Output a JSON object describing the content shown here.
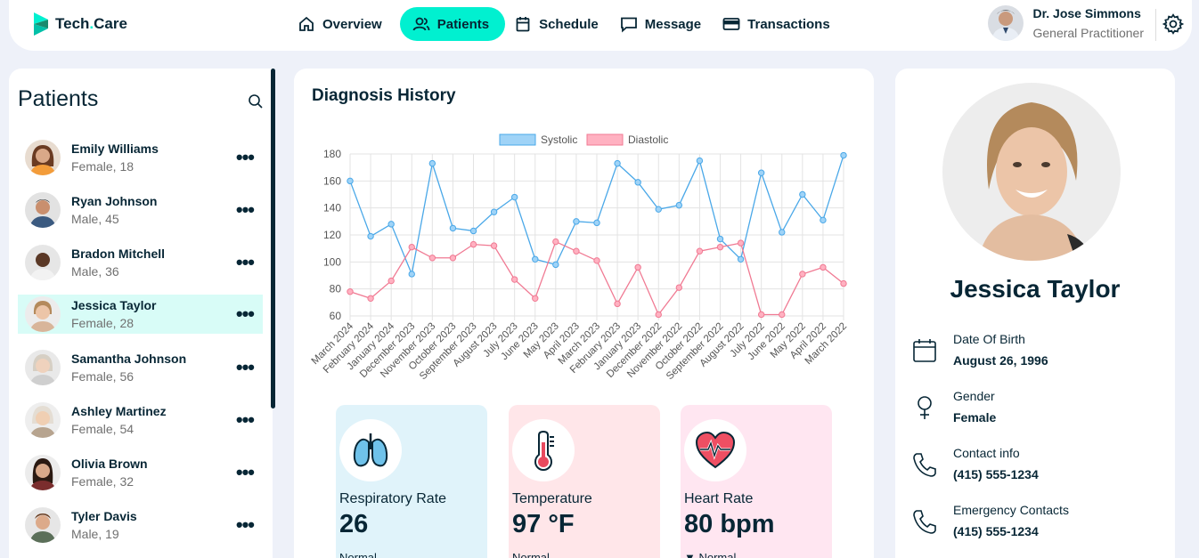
{
  "app": {
    "logo_main": "Tech",
    "logo_dot": ".",
    "logo_tail": "Care"
  },
  "nav": [
    {
      "label": "Overview",
      "icon": "home-icon"
    },
    {
      "label": "Patients",
      "icon": "users-icon",
      "active": true
    },
    {
      "label": "Schedule",
      "icon": "calendar-icon"
    },
    {
      "label": "Message",
      "icon": "chat-icon"
    },
    {
      "label": "Transactions",
      "icon": "credit-card-icon"
    }
  ],
  "doctor": {
    "name": "Dr. Jose Simmons",
    "role": "General Practitioner"
  },
  "patients_panel": {
    "title": "Patients",
    "items": [
      {
        "name": "Emily Williams",
        "meta": "Female, 18"
      },
      {
        "name": "Ryan Johnson",
        "meta": "Male, 45"
      },
      {
        "name": "Bradon Mitchell",
        "meta": "Male, 36"
      },
      {
        "name": "Jessica Taylor",
        "meta": "Female, 28",
        "selected": true
      },
      {
        "name": "Samantha Johnson",
        "meta": "Female, 56"
      },
      {
        "name": "Ashley Martinez",
        "meta": "Female, 54"
      },
      {
        "name": "Olivia Brown",
        "meta": "Female, 32"
      },
      {
        "name": "Tyler Davis",
        "meta": "Male, 19"
      }
    ],
    "more_glyph": "•••"
  },
  "diagnosis": {
    "title": "Diagnosis History",
    "vitals": [
      {
        "label": "Respiratory Rate",
        "value": "26",
        "note": "Normal",
        "bg": "#e0f3fa",
        "icon": "lungs-icon"
      },
      {
        "label": "Temperature",
        "value": "97 °F",
        "note": "Normal",
        "bg": "#ffe6e9",
        "icon": "thermometer-icon"
      },
      {
        "label": "Heart Rate",
        "value": "80 bpm",
        "note": "▼ Normal",
        "bg": "#ffe6f1",
        "icon": "heart-icon"
      }
    ]
  },
  "chart_data": {
    "type": "line",
    "categories": [
      "March 2024",
      "February 2024",
      "January 2024",
      "December 2023",
      "November 2023",
      "October 2023",
      "September 2023",
      "August 2023",
      "July 2023",
      "June 2023",
      "May 2023",
      "April 2023",
      "March 2023",
      "February 2023",
      "January 2023",
      "December 2022",
      "November 2022",
      "October 2022",
      "September 2022",
      "August 2022",
      "July 2022",
      "June 2022",
      "May 2022",
      "April 2022",
      "March 2022"
    ],
    "series": [
      {
        "name": "Systolic",
        "color": "#4aa8e8",
        "fill": "#9fd3f7",
        "values": [
          160,
          119,
          128,
          91,
          173,
          125,
          123,
          137,
          148,
          102,
          98,
          130,
          129,
          173,
          159,
          139,
          142,
          175,
          117,
          102,
          166,
          122,
          150,
          131,
          179
        ]
      },
      {
        "name": "Diastolic",
        "color": "#f07a93",
        "fill": "#ffb1c1",
        "values": [
          78,
          73,
          86,
          111,
          103,
          103,
          113,
          112,
          87,
          73,
          115,
          108,
          101,
          69,
          96,
          61,
          81,
          108,
          111,
          114,
          61,
          61,
          91,
          96,
          84
        ]
      }
    ],
    "ylim": [
      60,
      180
    ],
    "yticks": [
      60,
      80,
      100,
      120,
      140,
      160,
      180
    ],
    "grid": true,
    "legend": "top-center"
  },
  "selected_patient": {
    "name": "Jessica Taylor",
    "fields": [
      {
        "label": "Date Of Birth",
        "value": "August 26, 1996",
        "icon": "calendar-icon"
      },
      {
        "label": "Gender",
        "value": "Female",
        "icon": "female-icon"
      },
      {
        "label": "Contact info",
        "value": "(415) 555-1234",
        "icon": "phone-icon"
      },
      {
        "label": "Emergency Contacts",
        "value": "(415) 555-1234",
        "icon": "phone-icon"
      }
    ]
  }
}
